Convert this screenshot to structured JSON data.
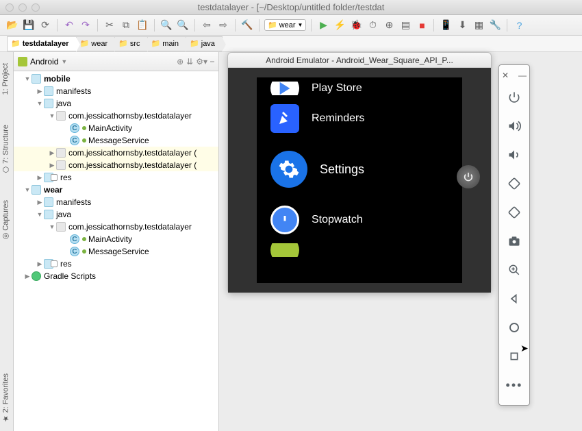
{
  "window": {
    "title": "testdatalayer - [~/Desktop/untitled folder/testdat"
  },
  "run_config": {
    "label": "wear"
  },
  "breadcrumbs": [
    "testdatalayer",
    "wear",
    "src",
    "main",
    "java"
  ],
  "project": {
    "mode": "Android",
    "tree": {
      "mobile": {
        "label": "mobile"
      },
      "mobile_manifests": {
        "label": "manifests"
      },
      "mobile_java": {
        "label": "java"
      },
      "mobile_pkg": {
        "label": "com.jessicathornsby.testdatalayer"
      },
      "mobile_main": {
        "label": "MainActivity"
      },
      "mobile_msg": {
        "label": "MessageService"
      },
      "mobile_pkg2": {
        "label": "com.jessicathornsby.testdatalayer ("
      },
      "mobile_pkg3": {
        "label": "com.jessicathornsby.testdatalayer ("
      },
      "mobile_res": {
        "label": "res"
      },
      "wear": {
        "label": "wear"
      },
      "wear_manifests": {
        "label": "manifests"
      },
      "wear_java": {
        "label": "java"
      },
      "wear_pkg": {
        "label": "com.jessicathornsby.testdatalayer"
      },
      "wear_main": {
        "label": "MainActivity"
      },
      "wear_msg": {
        "label": "MessageService"
      },
      "wear_res": {
        "label": "res"
      },
      "gradle": {
        "label": "Gradle Scripts"
      }
    }
  },
  "emulator": {
    "title": "Android Emulator - Android_Wear_Square_API_P...",
    "apps": {
      "playstore": "Play Store",
      "reminders": "Reminders",
      "settings": "Settings",
      "stopwatch": "Stopwatch"
    }
  },
  "gutter": {
    "project": "1: Project",
    "structure": "7: Structure",
    "captures": "Captures",
    "favorites": "2: Favorites"
  }
}
